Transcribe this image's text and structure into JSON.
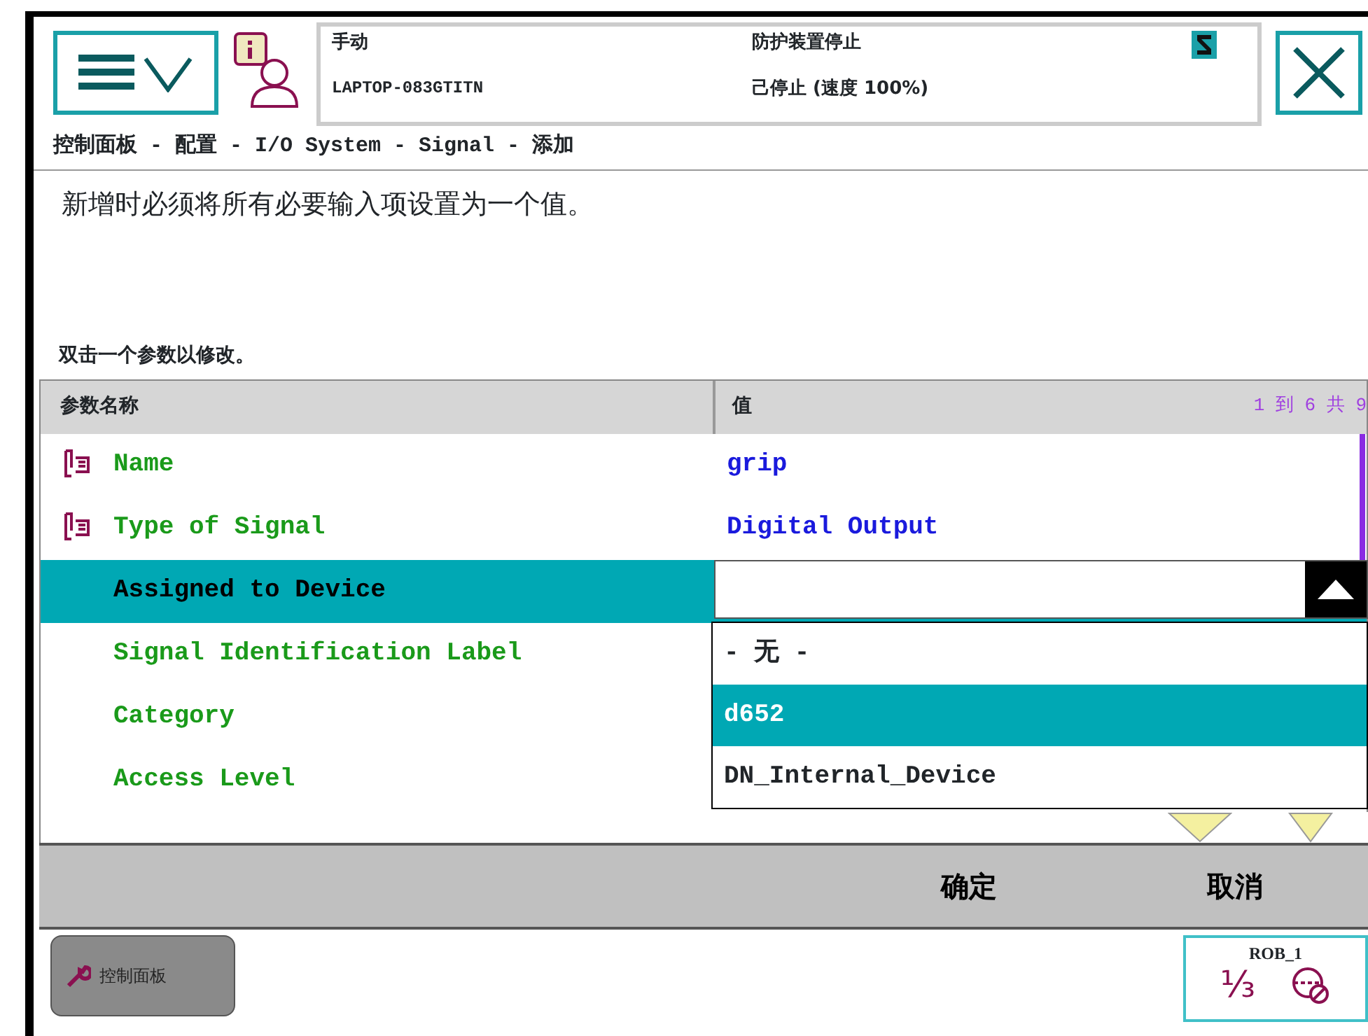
{
  "header": {
    "mode": "手动",
    "host": "LAPTOP-083GTITN",
    "guard": "防护装置停止",
    "state": "己停止 (速度 100%)"
  },
  "breadcrumb": "控制面板 - 配置 - I/O System - Signal - 添加",
  "message": "新增时必须将所有必要输入项设置为一个值。",
  "instruction": "双击一个参数以修改。",
  "table": {
    "columns": [
      "参数名称",
      "值"
    ],
    "page_info": "1 到 6 共 9",
    "rows": [
      {
        "name": "Name",
        "value": "grip",
        "kind": "required",
        "selected": false
      },
      {
        "name": "Type of Signal",
        "value": "Digital Output",
        "kind": "required",
        "selected": false
      },
      {
        "name": "Assigned to Device",
        "kind": "optional",
        "selected": true
      },
      {
        "name": "Signal Identification Label",
        "kind": "optional",
        "selected": false
      },
      {
        "name": "Category",
        "kind": "optional",
        "selected": false
      },
      {
        "name": "Access Level",
        "kind": "optional",
        "selected": false
      }
    ]
  },
  "dropdown": {
    "expanded": true,
    "options": [
      {
        "label": "- 无 -",
        "selected": false
      },
      {
        "label": "d652",
        "selected": true
      },
      {
        "label": "DN_Internal_Device",
        "selected": false
      }
    ]
  },
  "buttons": [
    "确定",
    "取消"
  ],
  "taskbar": {
    "button": "控制面板",
    "robot": "ROB_1",
    "fraction": "⅓"
  }
}
